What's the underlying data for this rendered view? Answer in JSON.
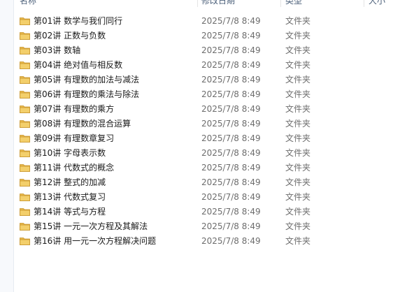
{
  "columns": {
    "name": "名称",
    "modified": "修改日期",
    "type": "类型",
    "size": "大小"
  },
  "icons": {
    "folder": "folder-icon",
    "folder_color": "#e8b84a"
  },
  "rows": [
    {
      "name": "第01讲 数学与我们同行",
      "modified": "2025/7/8 8:49",
      "type": "文件夹"
    },
    {
      "name": "第02讲 正数与负数",
      "modified": "2025/7/8 8:49",
      "type": "文件夹"
    },
    {
      "name": "第03讲 数轴",
      "modified": "2025/7/8 8:49",
      "type": "文件夹"
    },
    {
      "name": "第04讲 绝对值与相反数",
      "modified": "2025/7/8 8:49",
      "type": "文件夹"
    },
    {
      "name": "第05讲 有理数的加法与减法",
      "modified": "2025/7/8 8:49",
      "type": "文件夹"
    },
    {
      "name": "第06讲 有理数的乘法与除法",
      "modified": "2025/7/8 8:49",
      "type": "文件夹"
    },
    {
      "name": "第07讲 有理数的乘方",
      "modified": "2025/7/8 8:49",
      "type": "文件夹"
    },
    {
      "name": "第08讲 有理数的混合运算",
      "modified": "2025/7/8 8:49",
      "type": "文件夹"
    },
    {
      "name": "第09讲 有理数章复习",
      "modified": "2025/7/8 8:49",
      "type": "文件夹"
    },
    {
      "name": "第10讲 字母表示数",
      "modified": "2025/7/8 8:49",
      "type": "文件夹"
    },
    {
      "name": "第11讲 代数式的概念",
      "modified": "2025/7/8 8:49",
      "type": "文件夹"
    },
    {
      "name": "第12讲 整式的加减",
      "modified": "2025/7/8 8:49",
      "type": "文件夹"
    },
    {
      "name": "第13讲 代数式复习",
      "modified": "2025/7/8 8:49",
      "type": "文件夹"
    },
    {
      "name": "第14讲 等式与方程",
      "modified": "2025/7/8 8:49",
      "type": "文件夹"
    },
    {
      "name": "第15讲 一元一次方程及其解法",
      "modified": "2025/7/8 8:49",
      "type": "文件夹"
    },
    {
      "name": "第16讲 用一元一次方程解决问题",
      "modified": "2025/7/8 8:49",
      "type": "文件夹"
    }
  ]
}
